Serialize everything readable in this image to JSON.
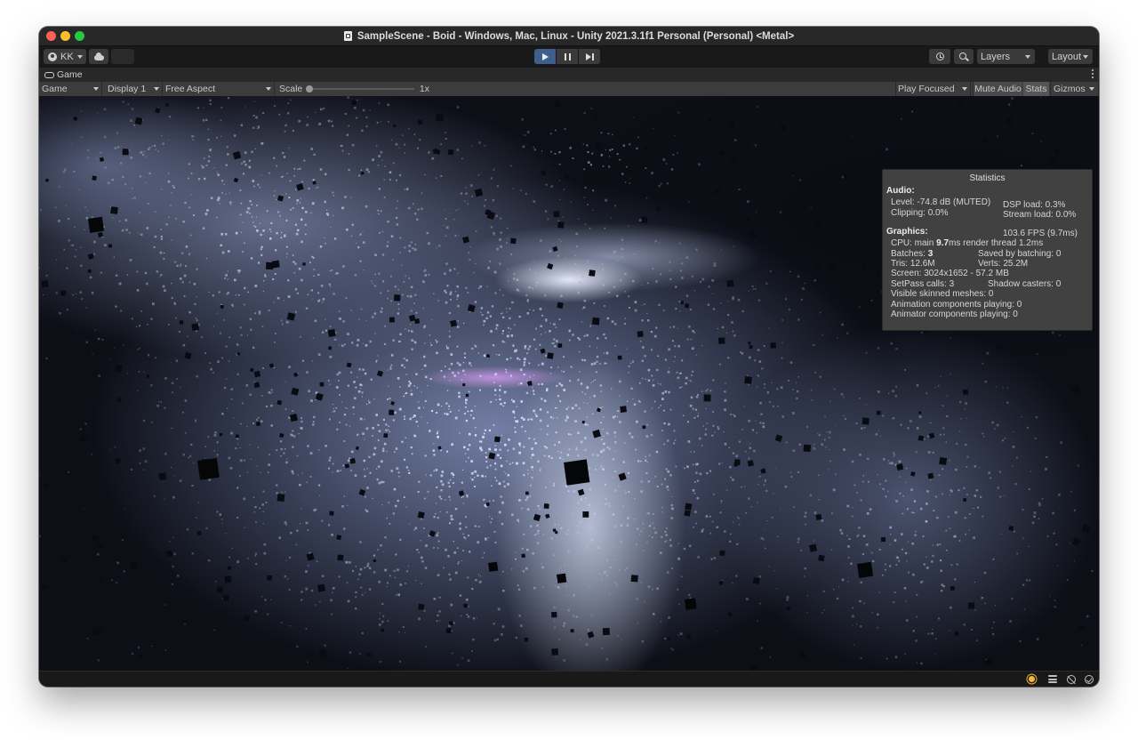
{
  "window": {
    "title": "SampleScene - Boid - Windows, Mac, Linux - Unity 2021.3.1f1 Personal (Personal) <Metal>"
  },
  "toolbar": {
    "account_label": "KK",
    "layers_label": "Layers",
    "layout_label": "Layout",
    "play_active": true
  },
  "tab": {
    "label": "Game"
  },
  "game_toolbar": {
    "view_select": "Game",
    "display_select": "Display 1",
    "aspect_select": "Free Aspect",
    "scale_label": "Scale",
    "scale_value": "1x",
    "play_mode_select": "Play Focused",
    "mute_audio_label": "Mute Audio",
    "stats_label": "Stats",
    "gizmos_label": "Gizmos"
  },
  "statistics": {
    "title": "Statistics",
    "audio_heading": "Audio:",
    "level": "Level: -74.8 dB (MUTED)",
    "dsp_load": "DSP load: 0.3%",
    "clipping": "Clipping: 0.0%",
    "stream_load": "Stream load: 0.0%",
    "graphics_heading": "Graphics:",
    "fps": "103.6 FPS (9.7ms)",
    "cpu_prefix": "CPU: main ",
    "cpu_main_value": "9.7",
    "cpu_suffix": "ms  render thread 1.2ms",
    "batches_prefix": "Batches: ",
    "batches_value": "3",
    "saved_by_batching": "Saved by batching: 0",
    "tris": "Tris: 12.6M",
    "verts": "Verts: 25.2M",
    "screen": "Screen: 3024x1652 - 57.2 MB",
    "setpass": "SetPass calls: 3",
    "shadow_casters": "Shadow casters: 0",
    "visible_skinned": "Visible skinned meshes: 0",
    "animation_components": "Animation components playing: 0",
    "animator_components": "Animator components playing: 0"
  },
  "colors": {
    "play_active": "#3e5f8c",
    "window_bg": "#191919",
    "panel_bg": "#444444",
    "accent_light": "#f2b73d"
  }
}
